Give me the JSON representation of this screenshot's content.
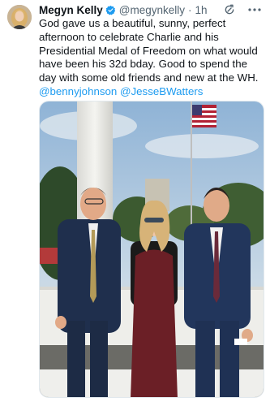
{
  "tweet": {
    "author_name": "Megyn Kelly",
    "handle": "@megynkelly",
    "separator": "·",
    "time": "1h",
    "text": "God gave us a beautiful, sunny, perfect afternoon to celebrate Charlie and his Presidential Medal of Freedom on what would have been his 32d bday. Good to spend the day with some old friends and new at the WH.",
    "mentions": "@bennyjohnson @JesseBWatters"
  },
  "icons": {
    "verified": "verified-badge-icon",
    "refresh": "grok-refresh-icon",
    "more": "more-options-icon"
  },
  "colors": {
    "accent": "#1d9bf0",
    "text": "#0f1419",
    "secondary": "#536471"
  }
}
